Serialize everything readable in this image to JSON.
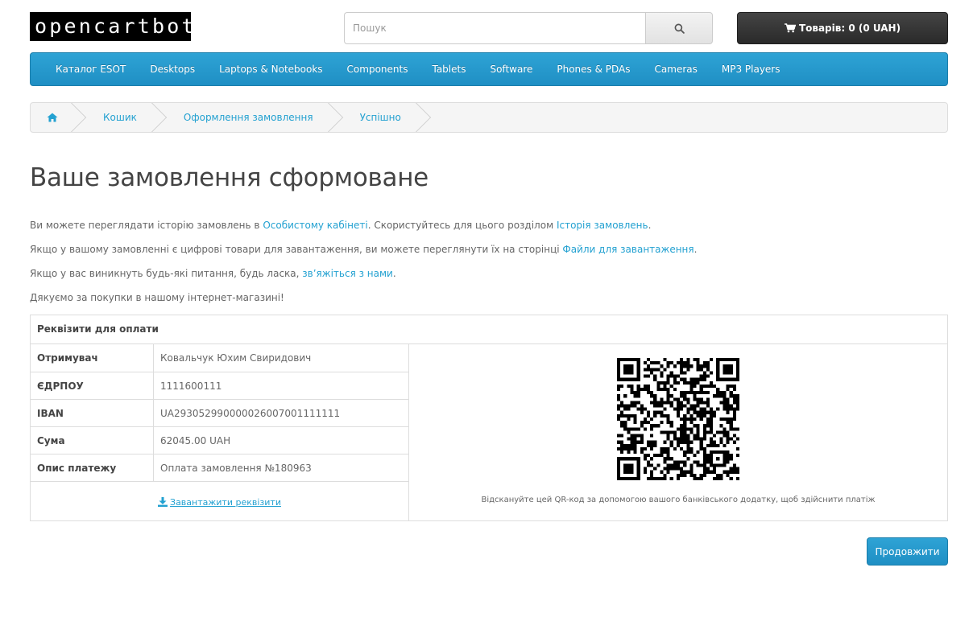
{
  "header": {
    "logo_text": "opencartbot",
    "search_placeholder": "Пошук",
    "cart_label": "Товарів: 0 (0 UAH)"
  },
  "menu": {
    "items": [
      {
        "label": "Каталог ESOT"
      },
      {
        "label": "Desktops"
      },
      {
        "label": "Laptops & Notebooks"
      },
      {
        "label": "Components"
      },
      {
        "label": "Tablets"
      },
      {
        "label": "Software"
      },
      {
        "label": "Phones & PDAs"
      },
      {
        "label": "Cameras"
      },
      {
        "label": "MP3 Players"
      }
    ]
  },
  "breadcrumb": {
    "items": [
      {
        "label": "Кошик"
      },
      {
        "label": "Оформлення замовлення"
      },
      {
        "label": "Успішно"
      }
    ]
  },
  "page": {
    "title": "Ваше замовлення сформоване",
    "p1_before": "Ви можете переглядати історію замовлень в ",
    "p1_link1": "Особистому кабінеті",
    "p1_middle": ". Скористуйтесь для цього розділом ",
    "p1_link2": "Історія замовлень",
    "p1_after": ".",
    "p2_before": "Якщо у вашому замовленні є цифрові товари для завантаження, ви можете переглянути їх на сторінці ",
    "p2_link": "Файли для завантаження",
    "p2_after": ".",
    "p3_before": "Якщо у вас виникнуть будь-які питання, будь ласка, ",
    "p3_link": "зв’яжіться з нами",
    "p3_after": ".",
    "p4": "Дякуємо за покупки в нашому інтернет-магазині!"
  },
  "payment": {
    "heading": "Реквізити для оплати",
    "rows": [
      {
        "label": "Отримувач",
        "value": "Ковальчук Юхим Свиридович"
      },
      {
        "label": "ЄДРПОУ",
        "value": "1111600111"
      },
      {
        "label": "IBAN",
        "value": "UA293052990000026007001111111"
      },
      {
        "label": "Сума",
        "value": "62045.00 UAH"
      },
      {
        "label": "Опис платежу",
        "value": "Оплата замовлення №180963"
      }
    ],
    "download_label": "Завантажити реквізити",
    "qr_note": "Відскануйте цей QR-код за допомогою вашого банківського додатку, щоб здійснити платіж"
  },
  "actions": {
    "continue_label": "Продовжити"
  },
  "colors": {
    "accent": "#229ac8",
    "link": "#23a1d1",
    "cart_bg": "#363636"
  }
}
